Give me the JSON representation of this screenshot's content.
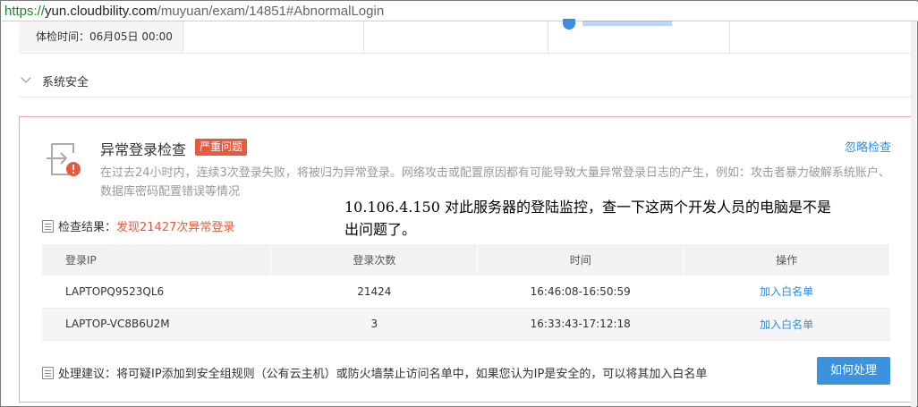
{
  "browser": {
    "url_scheme": "https://",
    "url_host": "yun.cloudbility.com",
    "url_path": "/muyuan/exam/14851#AbnormalLogin"
  },
  "top": {
    "check_time": "体检时间：06月05日 00:00"
  },
  "section": {
    "title": "系统安全"
  },
  "alert": {
    "title": "异常登录检查",
    "badge": "严重问题",
    "ignore_label": "忽略检查",
    "description": "在过去24小时内，连续3次登录失败，将被归为异常登录。网络攻击或配置原因都有可能导致大量异常登录日志的产生，例如：攻击者暴力破解系统账户、数据库密码配置错误等情况",
    "result_label": "检查结果：",
    "result_value": "发现21427次异常登录",
    "table": {
      "headers": [
        "登录IP",
        "登录次数",
        "时间",
        "操作"
      ],
      "rows": [
        {
          "ip": "LAPTOPQ9523QL6",
          "count": "21424",
          "time": "16:46:08-16:50:59",
          "action": "加入白名单"
        },
        {
          "ip": "LAPTOP-VC8B6U2M",
          "count": "3",
          "time": "16:33:43-17:12:18",
          "action": "加入白名单"
        }
      ]
    },
    "advice": "处理建议：将可疑IP添加到安全组规则（公有云主机）或防火墙禁止访问名单中，如果您认为IP是安全的，可以将其加入白名单",
    "how_button": "如何处理"
  },
  "annotation": {
    "line1": "10.106.4.150 对此服务器的登陆监控，查一下这两个开发人员的电脑是不是",
    "line2": "出问题了。"
  },
  "colors": {
    "danger": "#e9593d",
    "link": "#2f8ee0",
    "button": "#3b93df",
    "border_alert": "#f0a69e"
  },
  "icons": [
    "login-warning-icon",
    "clipboard-icon",
    "gear-icon",
    "chevron-down-icon"
  ]
}
